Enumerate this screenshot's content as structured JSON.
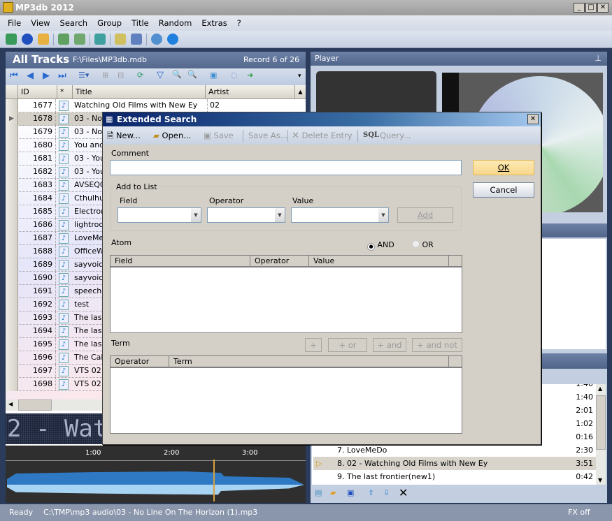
{
  "app": {
    "title": "MP3db 2012"
  },
  "menu": [
    "File",
    "View",
    "Search",
    "Group",
    "Title",
    "Random",
    "Extras",
    "?"
  ],
  "tracks_panel": {
    "title": "All Tracks",
    "path": "F:\\Files\\MP3db.mdb",
    "record": "Record 6 of 26",
    "columns": [
      "ID",
      "*",
      "Title",
      "Artist"
    ],
    "rows": [
      {
        "id": "1677",
        "title": "Watching Old Films with New Ey",
        "artist": "02"
      },
      {
        "id": "1678",
        "title": "03 - No",
        "artist": ""
      },
      {
        "id": "1679",
        "title": "03 - No",
        "artist": ""
      },
      {
        "id": "1680",
        "title": "You and",
        "artist": ""
      },
      {
        "id": "1681",
        "title": "03 - You",
        "artist": ""
      },
      {
        "id": "1682",
        "title": "03 - You",
        "artist": ""
      },
      {
        "id": "1683",
        "title": "AVSEQ0",
        "artist": ""
      },
      {
        "id": "1684",
        "title": "Cthulhu",
        "artist": ""
      },
      {
        "id": "1685",
        "title": "Electron",
        "artist": ""
      },
      {
        "id": "1686",
        "title": "lightroo",
        "artist": ""
      },
      {
        "id": "1687",
        "title": "LoveMe",
        "artist": ""
      },
      {
        "id": "1688",
        "title": "OfficeW",
        "artist": ""
      },
      {
        "id": "1689",
        "title": "sayvoic",
        "artist": ""
      },
      {
        "id": "1690",
        "title": "sayvoic",
        "artist": ""
      },
      {
        "id": "1691",
        "title": "speech",
        "artist": ""
      },
      {
        "id": "1692",
        "title": "test",
        "artist": ""
      },
      {
        "id": "1693",
        "title": "The last",
        "artist": ""
      },
      {
        "id": "1694",
        "title": "The last",
        "artist": ""
      },
      {
        "id": "1695",
        "title": "The last",
        "artist": ""
      },
      {
        "id": "1696",
        "title": "The Call",
        "artist": ""
      },
      {
        "id": "1697",
        "title": "VTS 02 :",
        "artist": ""
      },
      {
        "id": "1698",
        "title": "VTS 02 :",
        "artist": ""
      }
    ],
    "led_text": "2 - Wat",
    "timeline": [
      "1:00",
      "2:00",
      "3:00"
    ]
  },
  "player": {
    "title": "Player",
    "pin_icon": "pin-icon"
  },
  "playlist": {
    "rows": [
      {
        "label": "",
        "time": "1:40"
      },
      {
        "label": "",
        "time": "1:40"
      },
      {
        "label": "",
        "time": "2:01"
      },
      {
        "label": "",
        "time": "1:02"
      },
      {
        "label": "",
        "time": "0:16"
      },
      {
        "label": "7.  LoveMeDo",
        "time": "2:30"
      },
      {
        "label": "8.  02 - Watching Old Films with New Ey",
        "time": "3:51",
        "playing": true
      },
      {
        "label": "9.  The last frontier(new1)",
        "time": "0:42"
      }
    ]
  },
  "dialog": {
    "title": "Extended Search",
    "toolbar": {
      "new": "New...",
      "open": "Open...",
      "save": "Save",
      "save_as": "Save As...",
      "delete": "Delete Entry",
      "sql": "SQL",
      "query": "Query..."
    },
    "comment_label": "Comment",
    "comment_value": "",
    "ok": "OK",
    "cancel": "Cancel",
    "add_group": "Add to List",
    "field": "Field",
    "operator": "Operator",
    "value": "Value",
    "add": "Add",
    "atom": "Atom",
    "and": "AND",
    "or": "OR",
    "selected_logic": "AND",
    "atom_columns": [
      "Field",
      "Operator",
      "Value"
    ],
    "term": "Term",
    "term_buttons": [
      "+",
      "+ or",
      "+ and",
      "+ and not"
    ],
    "term_columns": [
      "Operator",
      "Term"
    ]
  },
  "status": {
    "state": "Ready",
    "file": "C:\\TMP\\mp3 audio\\03 - No Line On The Horizon (1).mp3",
    "fx": "FX off"
  },
  "colors": {
    "accent": "#2b3b5c",
    "ok_button": "#fbe4a4",
    "waveform": "#3a86d0"
  }
}
